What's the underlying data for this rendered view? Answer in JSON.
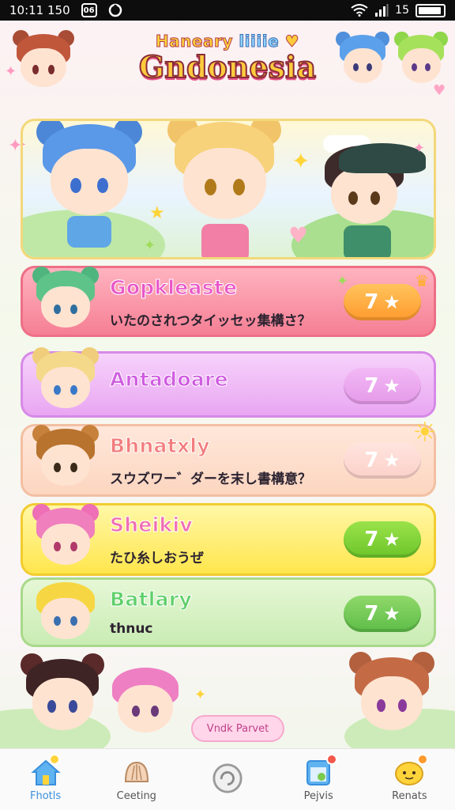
{
  "status_bar": {
    "time": "10:11 150",
    "badge": "06",
    "battery": "15"
  },
  "header": {
    "logo_top_1": "Haneary",
    "logo_top_2": "liiiie",
    "logo_main": "Gndonesia"
  },
  "cards": [
    {
      "title": "Gopkleaste",
      "subtitle": "いたのされつタイッセッ集構さ？",
      "count": "7",
      "accent": "#f57f94"
    },
    {
      "title": "Antadoare",
      "subtitle": "",
      "count": "7",
      "accent": "#e9a6f2"
    },
    {
      "title": "Bhnatxly",
      "subtitle": "スウズワー゛ダーを末し書構意？",
      "count": "7",
      "accent": "#fcd6c0"
    },
    {
      "title": "Sheikiv",
      "subtitle": "たひ糸しおうぜ",
      "count": "7",
      "accent": "#ffe64d"
    },
    {
      "title": "Batlary",
      "subtitle": "thnuc",
      "count": "7",
      "accent": "#c9ecb3"
    }
  ],
  "bottom_label": "Vndk Parvet",
  "nav": [
    {
      "label": "Fhotls",
      "icon": "house-icon",
      "active": true
    },
    {
      "label": "Ceeting",
      "icon": "fan-icon",
      "active": false
    },
    {
      "label": "",
      "icon": "refresh-icon",
      "active": false
    },
    {
      "label": "Pejvis",
      "icon": "calendar-icon",
      "active": false
    },
    {
      "label": "Renats",
      "icon": "character-face-icon",
      "active": false
    }
  ]
}
